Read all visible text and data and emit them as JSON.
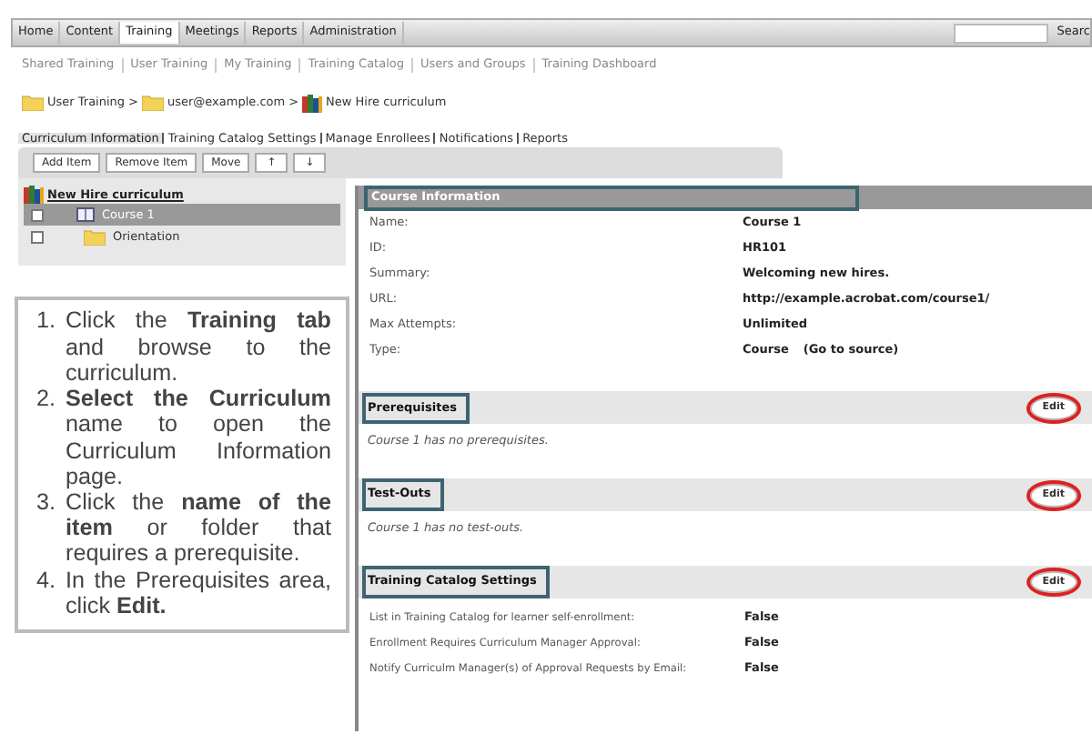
{
  "top_nav": {
    "items": [
      {
        "label": "Home",
        "selected": false
      },
      {
        "label": "Content",
        "selected": false
      },
      {
        "label": "Training",
        "selected": true
      },
      {
        "label": "Meetings",
        "selected": false
      },
      {
        "label": "Reports",
        "selected": false
      },
      {
        "label": "Administration",
        "selected": false
      }
    ],
    "search_button": "Searc"
  },
  "sub_nav": [
    "Shared Training",
    "User Training",
    "My Training",
    "Training Catalog",
    "Users and Groups",
    "Training Dashboard"
  ],
  "breadcrumb": [
    {
      "label": "User Training",
      "kind": "folder"
    },
    {
      "label": "user@example.com",
      "kind": "folder"
    },
    {
      "label": "New Hire curriculum",
      "kind": "curriculum"
    }
  ],
  "breadcrumb_separator": ">",
  "page_tabs": [
    {
      "label": "Curriculum Information",
      "selected": true
    },
    {
      "label": "Training Catalog Settings",
      "selected": false
    },
    {
      "label": "Manage Enrollees",
      "selected": false
    },
    {
      "label": "Notifications",
      "selected": false
    },
    {
      "label": "Reports",
      "selected": false
    }
  ],
  "toolbar": [
    "Add Item",
    "Remove Item",
    "Move",
    "↑",
    "↓"
  ],
  "tree": {
    "label": "New Hire curriculum",
    "children": [
      {
        "label": "Course 1",
        "kind": "course",
        "selected": true,
        "checked": false
      },
      {
        "label": "Orientation",
        "kind": "folder",
        "selected": false,
        "checked": false
      }
    ]
  },
  "instructions": [
    {
      "number": "1.",
      "text": "Click the **Training tab** and browse to the curriculum."
    },
    {
      "number": "2.",
      "text": "**Select the Curriculum** name to open the Curriculum Information page."
    },
    {
      "number": "3.",
      "text": "Click the **name of the item** or folder that requires a prerequisite."
    },
    {
      "number": "4.",
      "text": "In the Prerequisites area, click **Edit.**"
    }
  ],
  "course_information": {
    "title": "Course Information",
    "outlined": true,
    "fields": [
      {
        "label": "Name:",
        "value": "Course 1"
      },
      {
        "label": "ID:",
        "value": "HR101"
      },
      {
        "label": "Summary:",
        "value": "Welcoming new hires."
      },
      {
        "label": "URL:",
        "url": "http://example.acrobat.com/course1/"
      },
      {
        "label": "Max Attempts:",
        "value": "Unlimited"
      },
      {
        "label": "Type:",
        "value": "Course",
        "link": "(Go to source)"
      }
    ]
  },
  "sections": [
    {
      "title": "Prerequisites",
      "outlined": true,
      "button": "Edit",
      "button_circled": true,
      "note": "Course 1 has no prerequisites."
    },
    {
      "title": "Test-Outs",
      "outlined": true,
      "button": "Edit",
      "button_circled": true,
      "note": "Course 1 has no test-outs."
    },
    {
      "title": "Training Catalog Settings",
      "outlined": true,
      "button": "Edit",
      "button_circled": true,
      "fields": [
        {
          "label": "List in Training Catalog for learner self-enrollment:",
          "value": "False"
        },
        {
          "label": "Enrollment Requires Curriculum Manager Approval:",
          "value": "False"
        },
        {
          "label": "Notify Curriculm Manager(s) of Approval Requests by Email:",
          "value": "False"
        }
      ]
    }
  ]
}
